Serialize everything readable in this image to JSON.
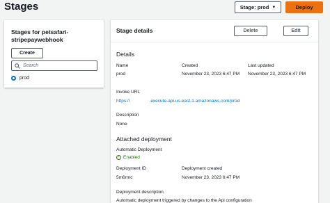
{
  "header": {
    "title": "Stages",
    "stage_select": "Stage: prod",
    "deploy_label": "Deploy"
  },
  "left": {
    "title": "Stages for petsafari-stripepaywebhook",
    "create_label": "Create",
    "search_placeholder": "Search",
    "stages": [
      {
        "label": "prod",
        "selected": true
      }
    ]
  },
  "right": {
    "title": "Stage details",
    "delete_label": "Delete",
    "edit_label": "Edit",
    "details": {
      "section_title": "Details",
      "name_label": "Name",
      "name_value": "prod",
      "created_label": "Created",
      "created_value": "November 23, 2023 6:47 PM",
      "updated_label": "Last updated",
      "updated_value": "November 23, 2023 6:47 PM",
      "invoke_label": "Invoke URL",
      "invoke_prefix": "https://",
      "invoke_suffix": ".execute-api.us-east-1.amazonaws.com/prod",
      "description_label": "Description",
      "description_value": "None"
    },
    "deployment": {
      "section_title": "Attached deployment",
      "auto_label": "Automatic Deployment",
      "auto_value": "Enabled",
      "id_label": "Deployment ID",
      "id_value": "5m6rmc",
      "created_label": "Deployment created",
      "created_value": "November 23, 2023 6:47 PM",
      "desc_label": "Deployment description",
      "desc_value": "Automatic deployment triggered by changes to the Api configuration"
    }
  },
  "colors": {
    "accent": "#ec7211",
    "link": "#0073bb",
    "success": "#1d8102"
  }
}
